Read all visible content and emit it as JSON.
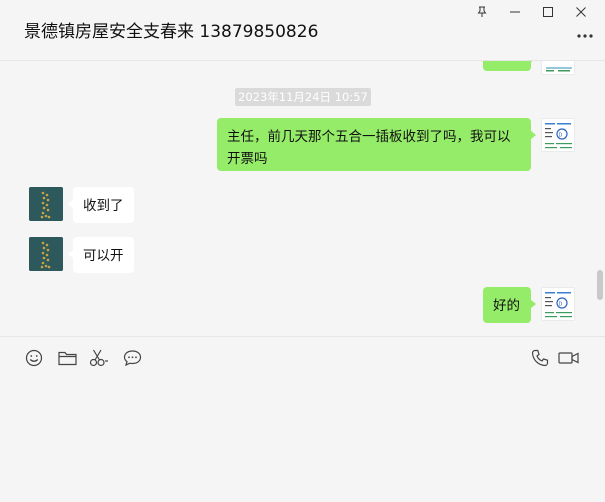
{
  "window": {
    "title": "景德镇房屋安全支春来 13879850826",
    "controls": [
      "pin-icon",
      "minimize-icon",
      "maximize-icon",
      "close-icon"
    ],
    "more_icon": "more-icon"
  },
  "conversation": {
    "timestamp": "2023年11月24日 10:57",
    "messages": [
      {
        "sender": "self",
        "text": "主任，前几天那个五合一插板收到了吗，我可以开票吗"
      },
      {
        "sender": "other",
        "text": "收到了"
      },
      {
        "sender": "other",
        "text": "可以开"
      },
      {
        "sender": "self",
        "text": "好的"
      }
    ]
  },
  "toolbar": {
    "left_tools": [
      "emoji-icon",
      "folder-icon",
      "scissors-icon",
      "chat-bubble-icon"
    ],
    "right_tools": [
      "phone-icon",
      "video-icon"
    ]
  },
  "colors": {
    "self_bubble": "#95ec69",
    "other_bubble": "#ffffff",
    "background": "#f5f5f5",
    "timestamp_bg": "#dadada"
  }
}
